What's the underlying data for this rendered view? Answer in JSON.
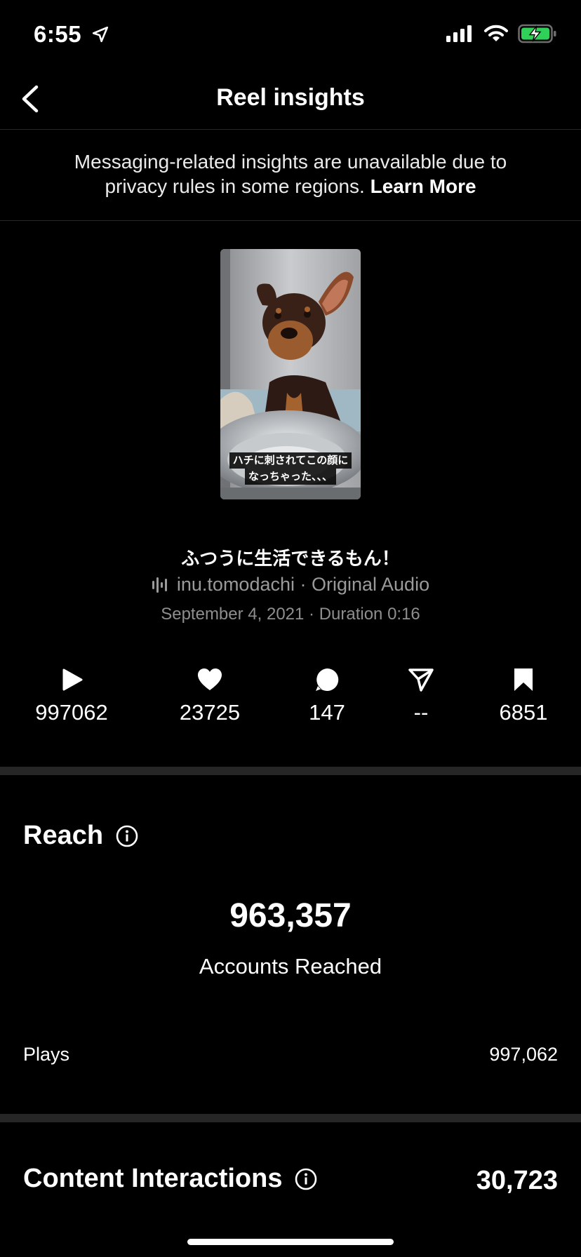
{
  "status_bar": {
    "time": "6:55"
  },
  "header": {
    "title": "Reel insights"
  },
  "notice": {
    "text": "Messaging-related insights are unavailable due to privacy rules in some regions.",
    "link": "Learn More"
  },
  "reel": {
    "overlay_line1": "ハチに刺されてこの顔に",
    "overlay_line2": "なっちゃった、、、",
    "caption": "ふつうに生活できるもん！",
    "audio": "inu.tomodachi · Original Audio",
    "date_duration": "September 4, 2021 · Duration 0:16"
  },
  "stats": {
    "plays": "997062",
    "likes": "23725",
    "comments": "147",
    "shares": "--",
    "saves": "6851"
  },
  "reach": {
    "title": "Reach",
    "accounts_reached": "963,357",
    "accounts_label": "Accounts Reached",
    "plays_label": "Plays",
    "plays_value": "997,062"
  },
  "content_interactions": {
    "title": "Content Interactions",
    "value": "30,723"
  }
}
